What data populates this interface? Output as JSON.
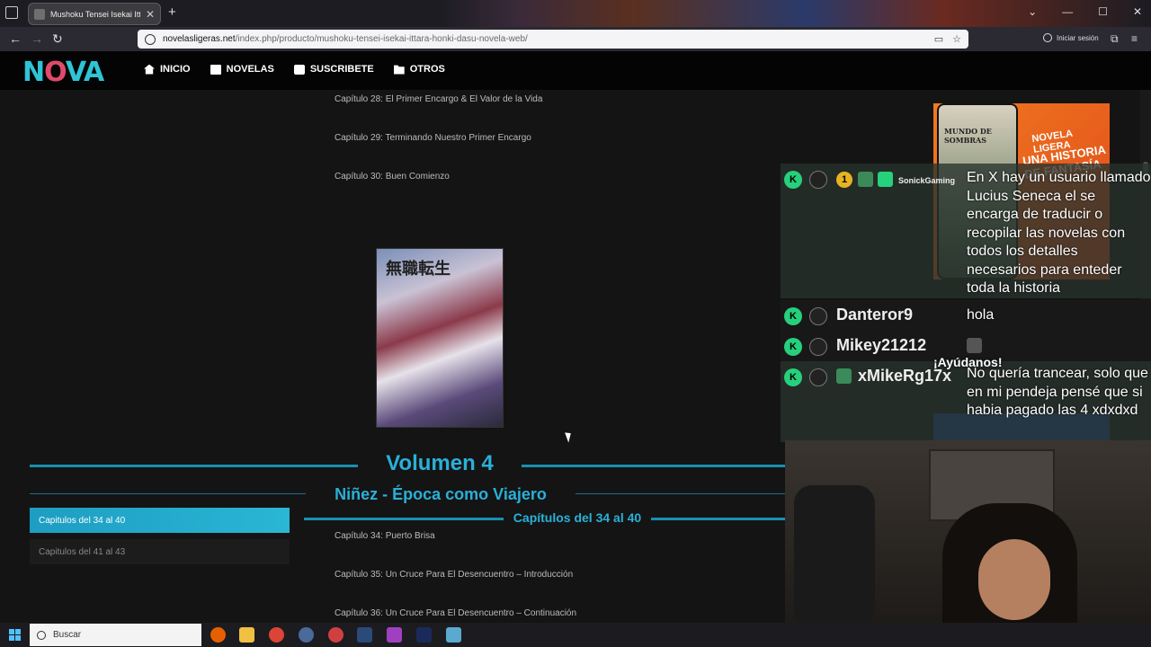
{
  "browser": {
    "tab_title": "Mushoku Tensei Isekai Ittara Ho...",
    "url_domain": "novelasligeras.net",
    "url_path": "/index.php/producto/mushoku-tensei-isekai-ittara-honki-dasu-novela-web/",
    "signin_label": "Iniciar sesión"
  },
  "site": {
    "logo": {
      "part1": "N",
      "part2": "O",
      "part3": "VA"
    },
    "menu": [
      {
        "label": "INICIO",
        "icon": "home-icon"
      },
      {
        "label": "NOVELAS",
        "icon": "cubes-icon"
      },
      {
        "label": "SUSCRIBETE",
        "icon": "check-square-icon"
      },
      {
        "label": "OTROS",
        "icon": "folder-open-icon"
      }
    ]
  },
  "chapters_top": [
    "Capítulo 28: El Primer Encargo & El Valor de la Vida",
    "Capítulo 29: Terminando Nuestro Primer Encargo",
    "Capítulo 30: Buen Comienzo"
  ],
  "cover": {
    "title": "無職転生"
  },
  "volume": {
    "title": "Volumen 4",
    "subtitle": "Niñez - Época como Viajero"
  },
  "chapter_tabs": [
    {
      "label": "Capitulos del 34 al 40",
      "active": true
    },
    {
      "label": "Capitulos del 41 al 43",
      "active": false
    }
  ],
  "section_title": "Capítulos del 34 al 40",
  "chapters_list": [
    "Capítulo 34: Puerto Brisa",
    "Capítulo 35: Un Cruce Para El Desencuentro – Introducción",
    "Capítulo 36: Un Cruce Para El Desencuentro – Continuación"
  ],
  "ad": {
    "phone_title": "MUNDO DE SOMBRAS",
    "text1": "NOVELA LIGERA",
    "text2": "UNA HISTORIA DE FANTASÍA"
  },
  "chat": [
    {
      "user": "SonickGaming",
      "badge": "1",
      "message": "En X hay un usuario llamado Lucius Seneca el se encarga de traducir o recopilar las novelas con todos los detalles necesarios para enteder toda la historia"
    },
    {
      "user": "Danteror9",
      "message": "hola"
    },
    {
      "user": "Mikey21212",
      "message": ""
    },
    {
      "user": "xMikeRg17x",
      "message": "No quería trancear, solo que en mi pendeja pensé que si habia pagado las 4 xdxdxd"
    }
  ],
  "overlay_label": "¡Ayúdanos!",
  "taskbar": {
    "search_placeholder": "Buscar"
  },
  "colors": {
    "accent": "#2ab0d8",
    "chat_badge": "#26d07c"
  }
}
